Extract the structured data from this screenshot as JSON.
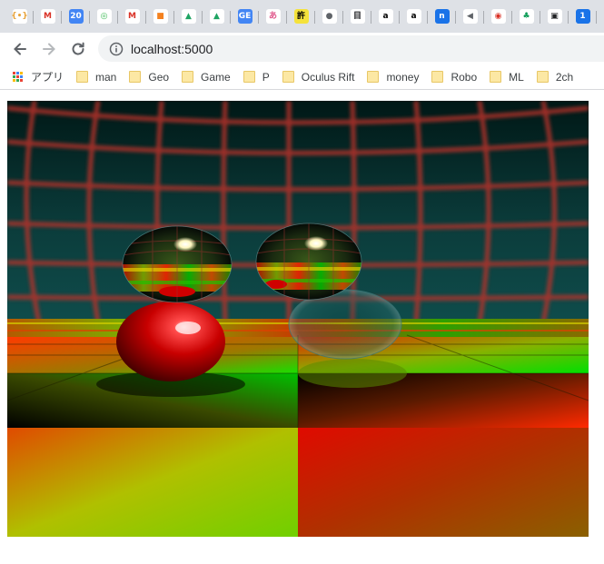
{
  "browser": {
    "pinned_tabs": [
      {
        "icon": "brackets-icon",
        "glyph": "{•}",
        "bg": "#ffffff",
        "fg": "#e8a33a"
      },
      {
        "icon": "gmail-icon",
        "glyph": "M",
        "bg": "#ffffff",
        "fg": "#d93025"
      },
      {
        "icon": "calendar-icon",
        "glyph": "20",
        "bg": "#4285f4",
        "fg": "#ffffff"
      },
      {
        "icon": "green-circle-icon",
        "glyph": "◎",
        "bg": "#ffffff",
        "fg": "#3cba54"
      },
      {
        "icon": "gmail-icon",
        "glyph": "M",
        "bg": "#ffffff",
        "fg": "#d93025"
      },
      {
        "icon": "package-icon",
        "glyph": "■",
        "bg": "#ffffff",
        "fg": "#f4811f"
      },
      {
        "icon": "drive-icon",
        "glyph": "▲",
        "bg": "#ffffff",
        "fg": "#1fa463"
      },
      {
        "icon": "drive-icon",
        "glyph": "▲",
        "bg": "#ffffff",
        "fg": "#1fa463"
      },
      {
        "icon": "sheets-icon",
        "glyph": "GE",
        "bg": "#4285f4",
        "fg": "#ffffff"
      },
      {
        "icon": "pink-glyph-icon",
        "glyph": "あ",
        "bg": "#ffffff",
        "fg": "#e0588c"
      },
      {
        "icon": "kanji-icon",
        "glyph": "許",
        "bg": "#f5e23b",
        "fg": "#000000"
      },
      {
        "icon": "globe-icon",
        "glyph": "●",
        "bg": "#ffffff",
        "fg": "#5f6368"
      },
      {
        "icon": "notebook-icon",
        "glyph": "目",
        "bg": "#ffffff",
        "fg": "#202124"
      },
      {
        "icon": "amazon-icon",
        "glyph": "a",
        "bg": "#ffffff",
        "fg": "#000000"
      },
      {
        "icon": "amazon-icon",
        "glyph": "a",
        "bg": "#ffffff",
        "fg": "#000000"
      },
      {
        "icon": "n-icon",
        "glyph": "n",
        "bg": "#1a73e8",
        "fg": "#ffffff"
      },
      {
        "icon": "speaker-icon",
        "glyph": "◀",
        "bg": "#ffffff",
        "fg": "#5f6368"
      },
      {
        "icon": "record-icon",
        "glyph": "◉",
        "bg": "#ffffff",
        "fg": "#d93025"
      },
      {
        "icon": "tree-icon",
        "glyph": "♣",
        "bg": "#ffffff",
        "fg": "#0f9d58"
      },
      {
        "icon": "tv-icon",
        "glyph": "▣",
        "bg": "#ffffff",
        "fg": "#202124"
      },
      {
        "icon": "blue-tab-icon",
        "glyph": "1",
        "bg": "#1a73e8",
        "fg": "#ffffff"
      }
    ],
    "address": "localhost:5000",
    "info_icon": "info-icon"
  },
  "bookmarks": {
    "apps_label": "アプリ",
    "items": [
      {
        "label": "man"
      },
      {
        "label": "Geo"
      },
      {
        "label": "Game"
      },
      {
        "label": "P"
      },
      {
        "label": "Oculus Rift"
      },
      {
        "label": "money"
      },
      {
        "label": "Robo"
      },
      {
        "label": "ML"
      },
      {
        "label": "2ch"
      }
    ]
  },
  "colors": {
    "sky_top": "#001a18",
    "sky_bottom": "#0d4a4a",
    "grid_line": "#b8312a",
    "floor_red": "#ff2000",
    "floor_green": "#00e000",
    "sphere_red": "#c80000"
  }
}
